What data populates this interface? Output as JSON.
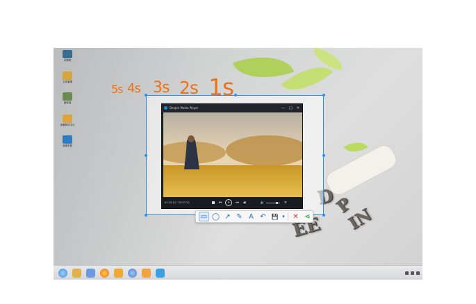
{
  "countdown": {
    "c5": "5s",
    "c4": "4s",
    "c3": "3s",
    "c2": "2s",
    "c1": "1s"
  },
  "player": {
    "title": "Deepin Media Player",
    "time": "01:22:12 / 02:07:22",
    "window_buttons": {
      "minimize": "—",
      "maximize": "□",
      "close": "✕"
    }
  },
  "toolbar": {
    "rect": "▭",
    "ellipse": "◯",
    "arrow": "↗",
    "pencil": "✎",
    "text": "A",
    "undo": "↶",
    "save": "💾",
    "save_menu": "▾",
    "cancel": "✕",
    "share": "⋖"
  },
  "desktop_icons": [
    {
      "label": "计算机",
      "color": "#3a6c8e"
    },
    {
      "label": "文件管理",
      "color": "#d4a63b"
    },
    {
      "label": "回收站",
      "color": "#6a8c52"
    },
    {
      "label": "深度软件中心",
      "color": "#e0a43a"
    },
    {
      "label": "深度手册",
      "color": "#2d7fc5"
    }
  ],
  "taskbar": {
    "icons": [
      "launcher-icon",
      "file-manager-icon",
      "system-settings-icon",
      "firefox-icon",
      "software-center-icon",
      "media-player-icon",
      "music-icon",
      "screenshot-icon"
    ],
    "icon_colors": [
      "#3a8fd6",
      "#e2b24a",
      "#6a9ae0",
      "#e8702a",
      "#f0a830",
      "#4a7fcc",
      "#f2a23a",
      "#3aa0e0"
    ]
  },
  "wallpaper": {
    "letters": "DEEPIN"
  },
  "colors": {
    "selection": "#2d8cf0",
    "countdown": "#e8731c",
    "toolbar_accent": "#1e6fc8",
    "cancel": "#d9342b",
    "share": "#3aa34a"
  }
}
